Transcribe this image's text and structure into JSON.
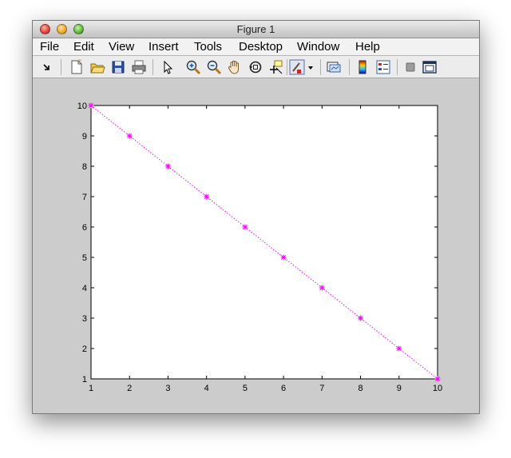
{
  "window": {
    "title": "Figure 1"
  },
  "menu": {
    "items": [
      "File",
      "Edit",
      "View",
      "Insert",
      "Tools",
      "Desktop",
      "Window",
      "Help"
    ]
  },
  "toolbar": {
    "buttons": [
      "dock-arrow-icon",
      "new-figure-icon",
      "open-file-icon",
      "save-icon",
      "print-icon",
      "pointer-icon",
      "zoom-in-icon",
      "zoom-out-icon",
      "pan-hand-icon",
      "rotate-3d-icon",
      "data-cursor-icon",
      "brush-icon",
      "dropdown-arrow-icon",
      "link-plot-icon",
      "colorbar-icon",
      "legend-icon",
      "hide-plot-tools-icon",
      "show-plot-tools-icon"
    ]
  },
  "chart_data": {
    "type": "line",
    "x": [
      1,
      2,
      3,
      4,
      5,
      6,
      7,
      8,
      9,
      10
    ],
    "series": [
      {
        "values": [
          10,
          9,
          8,
          7,
          6,
          5,
          4,
          3,
          2,
          1
        ],
        "color": "#ff00ff",
        "line_style": "dotted",
        "marker": "*"
      }
    ],
    "xlim": [
      1,
      10
    ],
    "ylim": [
      1,
      10
    ],
    "xticks": [
      "1",
      "2",
      "3",
      "4",
      "5",
      "6",
      "7",
      "8",
      "9",
      "10"
    ],
    "yticks": [
      "1",
      "2",
      "3",
      "4",
      "5",
      "6",
      "7",
      "8",
      "9",
      "10"
    ],
    "title": "",
    "xlabel": "",
    "ylabel": "",
    "grid": false
  }
}
